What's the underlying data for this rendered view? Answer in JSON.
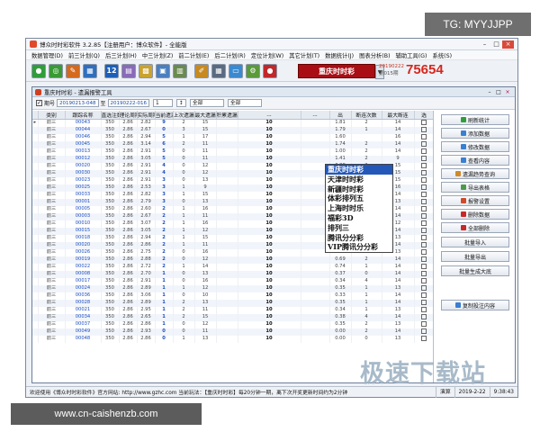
{
  "window": {
    "title": "博众时时彩软件 3.2.85【注册用户：博众软件】- 全能版"
  },
  "menu": [
    "数据管理(D)",
    "前三计划(Q)",
    "后三计划(H)",
    "中三计划(Z)",
    "前二计划(E)",
    "后二计划(R)",
    "定位计划(W)",
    "其它计划(T)",
    "数据统计(J)",
    "图表分析(B)",
    "辅助工具(G)",
    "系统(S)"
  ],
  "toolbar": {
    "icons": [
      {
        "name": "green-circle-icon",
        "color": "#2f9e3a",
        "glyph": "●"
      },
      {
        "name": "green-refresh-icon",
        "color": "#3a9a34",
        "glyph": "◎"
      },
      {
        "name": "pencil-icon",
        "color": "#d46a1f",
        "glyph": "✎"
      },
      {
        "name": "table-icon",
        "color": "#2f6fbd",
        "glyph": "▦"
      },
      {
        "name": "number-12-icon",
        "color": "#1d5fb8",
        "glyph": "12"
      },
      {
        "name": "chart-icon",
        "color": "#8a6bb8",
        "glyph": "▤"
      },
      {
        "name": "grid-icon",
        "color": "#c9a230",
        "glyph": "▩"
      },
      {
        "name": "book-icon",
        "color": "#4a7fc0",
        "glyph": "▣"
      },
      {
        "name": "notes-icon",
        "color": "#6a8a50",
        "glyph": "▥"
      },
      {
        "name": "brush-icon",
        "color": "#c78a20",
        "glyph": "✐"
      },
      {
        "name": "calculator-icon",
        "color": "#5a6a80",
        "glyph": "▦"
      },
      {
        "name": "monitor-icon",
        "color": "#3a8ad0",
        "glyph": "▭"
      },
      {
        "name": "gear-icon",
        "color": "#5a9a3a",
        "glyph": "⚙"
      },
      {
        "name": "red-stop-icon",
        "color": "#c0282a",
        "glyph": "●"
      }
    ],
    "lottery_selected": "重庆时时彩",
    "issue_date": "20190222",
    "issue_sub": "第015期",
    "draw_number": "75654"
  },
  "subwindow": {
    "title": "重庆时时彩 - 遗漏报警工具"
  },
  "filter": {
    "checkbox_mark": "✓",
    "label": "期号",
    "date_from": "20190213-048",
    "sep": "至",
    "date_to": "20190222-016",
    "spin": "1",
    "spin_arrows": "↕",
    "position": "全部",
    "type": "全部"
  },
  "table": {
    "columns": [
      "类别",
      "跟踪名称",
      "直选注数",
      "理论周期",
      "实际周期",
      "当前遗漏",
      "上次遗漏",
      "最大遗漏",
      "积累遗漏",
      "...",
      "...",
      "出",
      "断连次数",
      "最大断连",
      "选"
    ],
    "rows": [
      [
        "前三",
        "00043",
        "350",
        "2.86",
        "2.82",
        "9",
        "2",
        "15",
        "",
        "10",
        "1.81",
        "2",
        "14"
      ],
      [
        "前三",
        "00044",
        "350",
        "2.86",
        "2.67",
        "0",
        "3",
        "15",
        "",
        "10",
        "1.79",
        "1",
        "14"
      ],
      [
        "前三",
        "00046",
        "350",
        "2.86",
        "2.94",
        "5",
        "1",
        "17",
        "",
        "10",
        "1.60",
        "",
        "16"
      ],
      [
        "前三",
        "00045",
        "350",
        "2.86",
        "3.14",
        "6",
        "2",
        "11",
        "",
        "10",
        "1.74",
        "2",
        "14"
      ],
      [
        "前三",
        "00013",
        "350",
        "2.86",
        "2.91",
        "5",
        "0",
        "11",
        "",
        "10",
        "1.00",
        "2",
        "14"
      ],
      [
        "前三",
        "00012",
        "350",
        "2.86",
        "3.05",
        "5",
        "0",
        "11",
        "",
        "10",
        "1.41",
        "2",
        "9"
      ],
      [
        "前三",
        "00020",
        "350",
        "2.86",
        "2.91",
        "4",
        "0",
        "12",
        "",
        "10",
        "0.88",
        "2",
        "15"
      ],
      [
        "前三",
        "00030",
        "350",
        "2.86",
        "2.91",
        "4",
        "0",
        "12",
        "",
        "10",
        "0.88",
        "4",
        "15"
      ],
      [
        "前三",
        "00023",
        "350",
        "2.86",
        "2.91",
        "3",
        "0",
        "13",
        "",
        "10",
        "1.07",
        "2",
        "15"
      ],
      [
        "前三",
        "00025",
        "350",
        "2.86",
        "2.53",
        "3",
        "1",
        "9",
        "",
        "10",
        "1.19",
        "1",
        "16"
      ],
      [
        "前三",
        "00033",
        "350",
        "2.86",
        "2.82",
        "3",
        "1",
        "15",
        "",
        "10",
        "0.83",
        "1",
        "14"
      ],
      [
        "前三",
        "00001",
        "350",
        "2.86",
        "2.79",
        "3",
        "0",
        "13",
        "",
        "10",
        "0.72",
        "1",
        "13"
      ],
      [
        "前三",
        "00005",
        "350",
        "2.86",
        "2.60",
        "2",
        "1",
        "16",
        "",
        "10",
        "0.67",
        "4",
        "14"
      ],
      [
        "前三",
        "00003",
        "350",
        "2.86",
        "2.67",
        "2",
        "1",
        "11",
        "",
        "10",
        "0.75",
        "2",
        "14"
      ],
      [
        "前三",
        "00010",
        "350",
        "2.86",
        "3.07",
        "2",
        "1",
        "16",
        "",
        "10",
        "0.65",
        "3",
        "12"
      ],
      [
        "前三",
        "00015",
        "350",
        "2.86",
        "3.05",
        "2",
        "1",
        "12",
        "",
        "10",
        "0.66",
        "2",
        "14"
      ],
      [
        "前三",
        "00018",
        "350",
        "2.86",
        "2.94",
        "2",
        "1",
        "15",
        "",
        "10",
        "0.68",
        "3",
        "13"
      ],
      [
        "前三",
        "00020",
        "350",
        "2.86",
        "2.86",
        "2",
        "1",
        "11",
        "",
        "10",
        "0.70",
        "2",
        "14"
      ],
      [
        "前三",
        "00026",
        "350",
        "2.86",
        "2.75",
        "2",
        "0",
        "16",
        "",
        "10",
        "0.73",
        "2",
        "13"
      ],
      [
        "前三",
        "00019",
        "350",
        "2.86",
        "2.88",
        "2",
        "0",
        "12",
        "",
        "10",
        "0.69",
        "2",
        "14"
      ],
      [
        "前三",
        "00022",
        "350",
        "2.86",
        "2.72",
        "2",
        "1",
        "14",
        "",
        "10",
        "0.74",
        "1",
        "14"
      ],
      [
        "前三",
        "00008",
        "350",
        "2.86",
        "2.70",
        "1",
        "0",
        "13",
        "",
        "10",
        "0.37",
        "0",
        "14"
      ],
      [
        "前三",
        "00017",
        "350",
        "2.86",
        "2.91",
        "1",
        "0",
        "16",
        "",
        "10",
        "0.34",
        "4",
        "14"
      ],
      [
        "前三",
        "00024",
        "350",
        "2.86",
        "2.89",
        "1",
        "1",
        "12",
        "",
        "10",
        "0.35",
        "1",
        "13"
      ],
      [
        "前三",
        "00036",
        "350",
        "2.86",
        "3.06",
        "1",
        "0",
        "10",
        "",
        "10",
        "0.33",
        "1",
        "14"
      ],
      [
        "前三",
        "00028",
        "350",
        "2.86",
        "2.89",
        "1",
        "2",
        "13",
        "",
        "10",
        "0.35",
        "1",
        "14"
      ],
      [
        "前三",
        "00021",
        "350",
        "2.86",
        "2.95",
        "1",
        "2",
        "11",
        "",
        "10",
        "0.34",
        "1",
        "13"
      ],
      [
        "前三",
        "00034",
        "350",
        "2.86",
        "2.65",
        "1",
        "2",
        "15",
        "",
        "10",
        "0.38",
        "4",
        "14"
      ],
      [
        "前三",
        "00037",
        "350",
        "2.86",
        "2.86",
        "1",
        "0",
        "12",
        "",
        "10",
        "0.35",
        "2",
        "13"
      ],
      [
        "前三",
        "00049",
        "350",
        "2.86",
        "2.93",
        "0",
        "0",
        "11",
        "",
        "10",
        "0.00",
        "2",
        "14"
      ],
      [
        "前三",
        "00048",
        "350",
        "2.86",
        "2.86",
        "0",
        "1",
        "13",
        "",
        "10",
        "0.00",
        "0",
        "13"
      ]
    ]
  },
  "dropdown_options": [
    "重庆时时彩",
    "天津时时彩",
    "新疆时时彩",
    "体彩排列五",
    "上海时时乐",
    "福彩3D",
    "排列三",
    "腾讯分分彩",
    "VIP腾讯分分彩"
  ],
  "side_buttons": [
    {
      "label": "刷新统计",
      "color": "#2f9e3a"
    },
    {
      "label": "添加数据",
      "color": "#3a7fd0"
    },
    {
      "label": "修改数据",
      "color": "#3a7fd0"
    },
    {
      "label": "查看内容",
      "color": "#3a7fd0"
    },
    {
      "label": "遗漏趋势查询",
      "color": "#d08a2a"
    },
    {
      "label": "导出表格",
      "color": "#4a9a4a"
    },
    {
      "label": "报警设置",
      "color": "#d04a2a"
    },
    {
      "label": "删除数据",
      "color": "#c82828"
    },
    {
      "label": "全部删除",
      "color": "#c82828"
    },
    {
      "label": "批量导入",
      "color": ""
    },
    {
      "label": "批量导出",
      "color": ""
    },
    {
      "label": "批量生成大底",
      "color": ""
    },
    {
      "label": "复制投注内容",
      "color": "#3a7fd0"
    }
  ],
  "status": {
    "main": "欢迎使用《博众时时彩软件》官方网站: http://www.gzhc.com 当前玩法：【重庆时时彩】每20分钟一期，离下次开奖更新时间约为2分钟",
    "mode": "演算",
    "date": "2019-2-22",
    "time": "9:38:43"
  },
  "watermarks": {
    "top_right": "TG: MYYJJPP",
    "bottom_left": "www.cn-caishenzb.com",
    "bottom_right": "极速下载站"
  }
}
